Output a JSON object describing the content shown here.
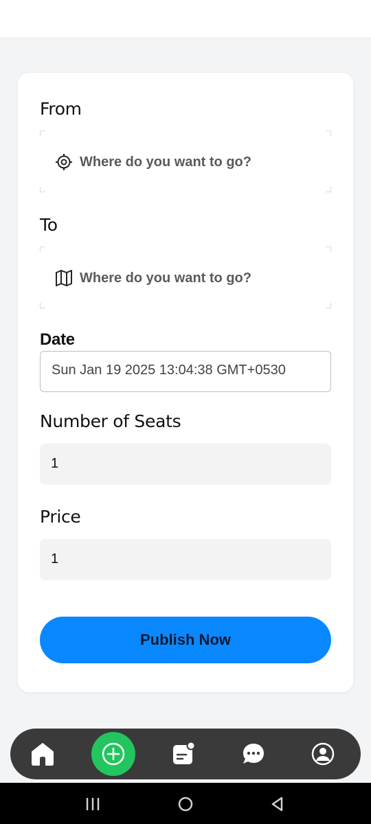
{
  "form": {
    "from_label": "From",
    "from_placeholder": "Where do you want to go?",
    "to_label": "To",
    "to_placeholder": "Where do you want to go?",
    "date_label": "Date",
    "date_value": "Sun Jan 19 2025 13:04:38 GMT+0530",
    "seats_label": "Number of Seats",
    "seats_value": "1",
    "price_label": "Price",
    "price_value": "1",
    "publish_label": "Publish Now"
  },
  "nav": {
    "items": [
      {
        "icon": "home-icon"
      },
      {
        "icon": "add-circle-icon",
        "active": true
      },
      {
        "icon": "rides-list-icon"
      },
      {
        "icon": "chat-icon"
      },
      {
        "icon": "profile-icon"
      }
    ]
  },
  "system_nav": [
    "recents-icon",
    "home-circle-icon",
    "back-icon"
  ],
  "colors": {
    "accent": "#0a88ff",
    "add_button": "#22c55e",
    "nav_bg": "#3a3a3a",
    "page_bg": "#f3f4f6"
  }
}
